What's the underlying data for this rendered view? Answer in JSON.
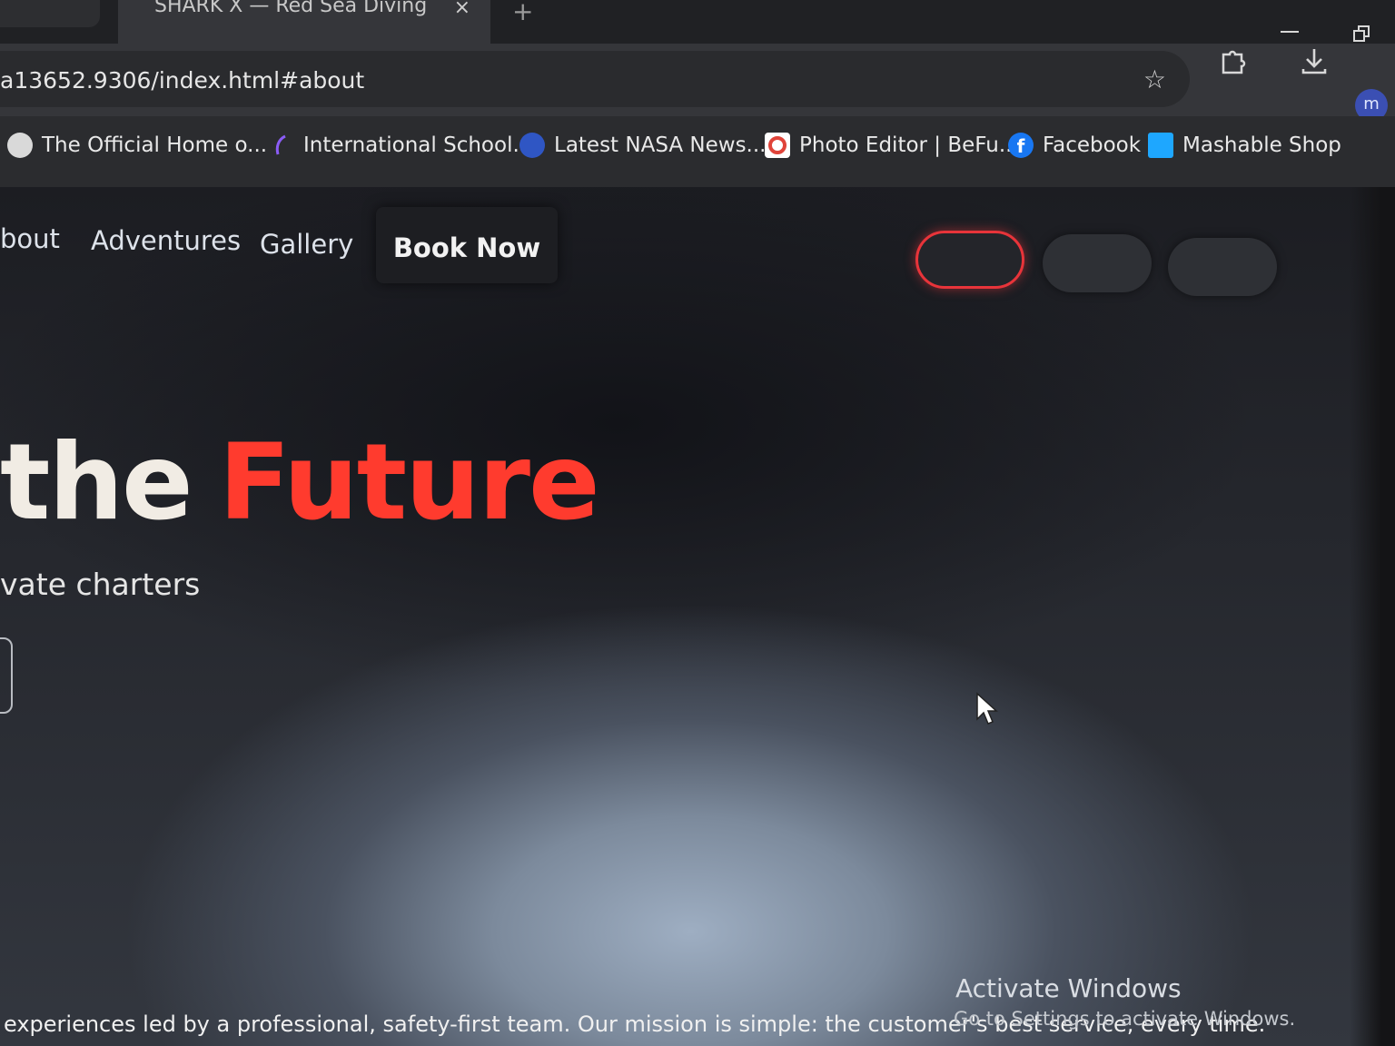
{
  "browser": {
    "tab_title": "SHARK X — Red Sea Diving",
    "tab_close": "×",
    "new_tab": "+",
    "url": "a13652.9306/index.html#about",
    "avatar_letter": "m"
  },
  "bookmarks": [
    {
      "label": "The Official Home o...",
      "icon": "globe-icon",
      "color": "#d9d9d9"
    },
    {
      "label": "International School...",
      "icon": "feather-icon",
      "color": "#8b5cf6"
    },
    {
      "label": "Latest NASA News...",
      "icon": "nasa-icon",
      "color": "#2f56c4"
    },
    {
      "label": "Photo Editor | BeFu...",
      "icon": "befunky-icon",
      "color": "#ffffff"
    },
    {
      "label": "Facebook",
      "icon": "facebook-icon",
      "color": "#1877f2"
    },
    {
      "label": "Mashable Shop",
      "icon": "mashable-icon",
      "color": "#1ea7ff"
    }
  ],
  "nav": {
    "links": [
      "bout",
      "Adventures",
      "Gallery"
    ],
    "book_now": "Book Now",
    "lang_pills": [
      "",
      "",
      ""
    ]
  },
  "hero": {
    "title_plain": "the",
    "title_accent": "Future",
    "subtitle": "vate charters",
    "mission": "experiences led by a professional, safety-first team. Our mission is simple: the customer's best service, every time."
  },
  "watermark": {
    "title": "Activate Windows",
    "subtitle": "Go to Settings to activate Windows."
  },
  "colors": {
    "accent": "#ff3b2e",
    "active_pill_border": "#e8343a",
    "chrome_bg": "#202124"
  }
}
